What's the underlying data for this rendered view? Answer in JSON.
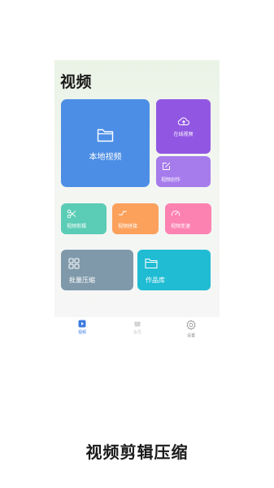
{
  "page": {
    "title": "视频"
  },
  "cards": {
    "local": {
      "label": "本地视频",
      "icon": "folder-icon"
    },
    "online": {
      "label": "在线视频",
      "icon": "cloud-upload-icon"
    },
    "create": {
      "label": "视频创作",
      "icon": "edit-icon"
    },
    "cut": {
      "label": "视频剪辑",
      "icon": "scissors-icon"
    },
    "join": {
      "label": "视频拼接",
      "icon": "join-icon"
    },
    "speed": {
      "label": "视频变速",
      "icon": "speedometer-icon"
    },
    "batch": {
      "label": "批量压缩",
      "icon": "grid-icon"
    },
    "works": {
      "label": "作品库",
      "icon": "folder-icon"
    }
  },
  "colors": {
    "local": "#4c8ee5",
    "online": "#9257e2",
    "create": "#a67bec",
    "cut": "#5bccb5",
    "join": "#fba15c",
    "speed": "#fc82b1",
    "batch": "#7f99aa",
    "works": "#1fbcd3",
    "tab_active": "#3d7be0"
  },
  "tabbar": {
    "items": [
      {
        "label": "视频",
        "icon": "play-icon",
        "active": true
      },
      {
        "label": "会员",
        "icon": "crown-icon",
        "active": false
      },
      {
        "label": "设置",
        "icon": "gear-icon",
        "active": false
      }
    ]
  },
  "caption": "视频剪辑压缩"
}
